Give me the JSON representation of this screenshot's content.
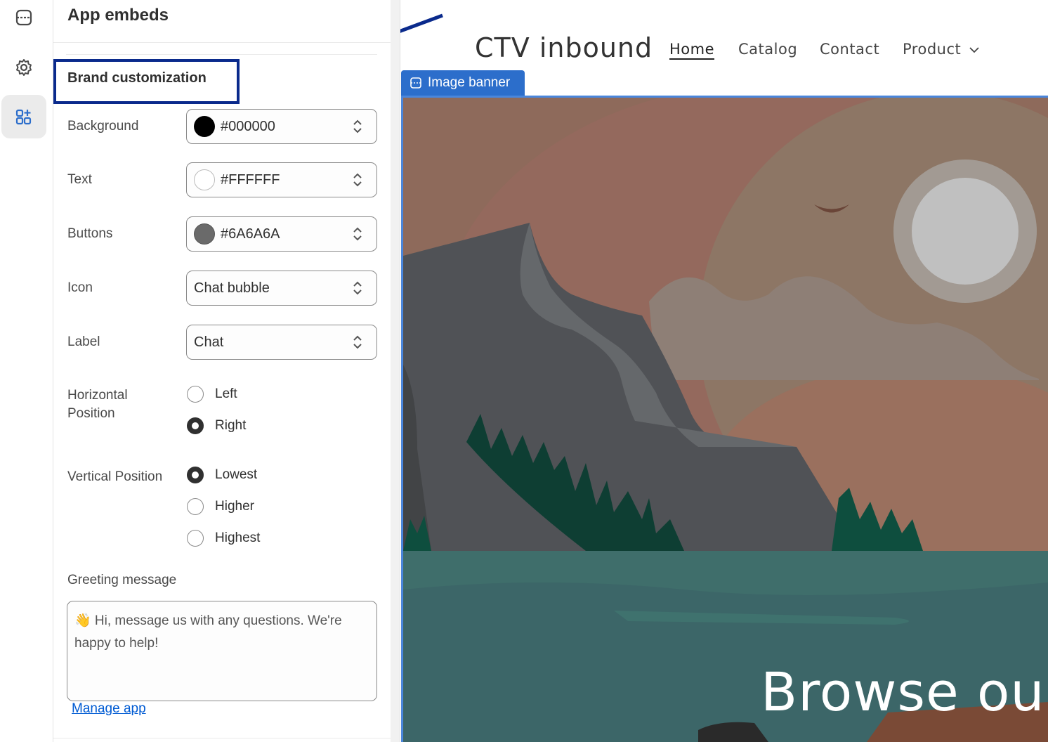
{
  "panel": {
    "title": "App embeds",
    "section_title": "Brand customization",
    "background": {
      "label": "Background",
      "value": "#000000",
      "swatch": "#000000"
    },
    "text": {
      "label": "Text",
      "value": "#FFFFFF",
      "swatch": "#FFFFFF"
    },
    "buttons": {
      "label": "Buttons",
      "value": "#6A6A6A",
      "swatch": "#6A6A6A"
    },
    "icon": {
      "label": "Icon",
      "value": "Chat bubble"
    },
    "label_field": {
      "label": "Label",
      "value": "Chat"
    },
    "horizontal": {
      "label": "Horizontal Position",
      "options": [
        "Left",
        "Right"
      ],
      "selected": "Right"
    },
    "vertical": {
      "label": "Vertical Position",
      "options": [
        "Lowest",
        "Higher",
        "Highest"
      ],
      "selected": "Lowest"
    },
    "greeting": {
      "label": "Greeting message",
      "value": "👋 Hi, message us with any questions. We're happy to help!"
    },
    "manage_link": "Manage app"
  },
  "preview": {
    "store_name": "CTV inbound",
    "nav": [
      "Home",
      "Catalog",
      "Contact",
      "Product"
    ],
    "active_nav": "Home",
    "section_tag": "Image banner",
    "hero_heading": "Browse our"
  },
  "icons": {
    "rail": [
      "sections-icon",
      "gear-icon",
      "apps-icon"
    ],
    "selects": "chevron-updown-icon",
    "product_dropdown": "chevron-down-icon"
  },
  "colors": {
    "accent": "#2c6ecb",
    "annotation": "#0a2a8c",
    "link": "#005bd3"
  }
}
